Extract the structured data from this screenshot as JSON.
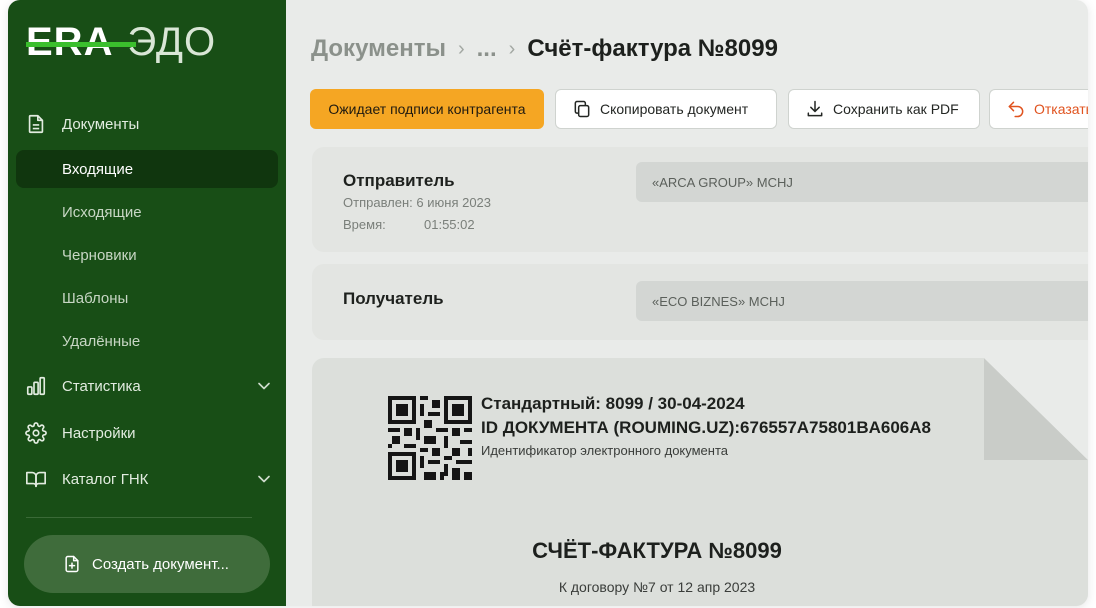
{
  "logo": {
    "brand": "ERA",
    "product": "ЭДО"
  },
  "sidebar": {
    "documents_label": "Документы",
    "sub_items": [
      "Входящие",
      "Исходящие",
      "Черновики",
      "Шаблоны",
      "Удалённые"
    ],
    "statistics_label": "Статистика",
    "settings_label": "Настройки",
    "catalog_label": "Каталог ГНК",
    "create_button_label": "Создать документ..."
  },
  "breadcrumb": {
    "root": "Документы",
    "ellipsis": "...",
    "current": "Счёт-фактура №8099"
  },
  "toolbar": {
    "status_label": "Ожидает подписи контрагента",
    "copy_label": "Скопировать документ",
    "save_pdf_label": "Сохранить как PDF",
    "reject_label": "Отказать"
  },
  "sender": {
    "title": "Отправитель",
    "sent_label": "Отправлен:",
    "sent_date": "6 июня 2023",
    "time_label": "Время:",
    "time_value": "01:55:02",
    "company": "«ARCA GROUP» MCHJ"
  },
  "recipient": {
    "title": "Получатель",
    "company": "«ECO BIZNES» MCHJ"
  },
  "document": {
    "standard_line": "Стандартный: 8099 / 30-04-2024",
    "id_line": "ID ДОКУМЕНТА (ROUMING.UZ):676557A75801BA606A8",
    "id_caption": "Идентификатор электронного документа",
    "title": "СЧЁТ-ФАКТУРА №8099",
    "contract": "К договору №7 от 12 апр 2023"
  },
  "colors": {
    "sidebar_bg": "#184e16",
    "active_item_bg": "#10360e",
    "logo_accent": "#3bbf2d",
    "status_badge": "#f5a623",
    "reject_accent": "#e0531f"
  }
}
